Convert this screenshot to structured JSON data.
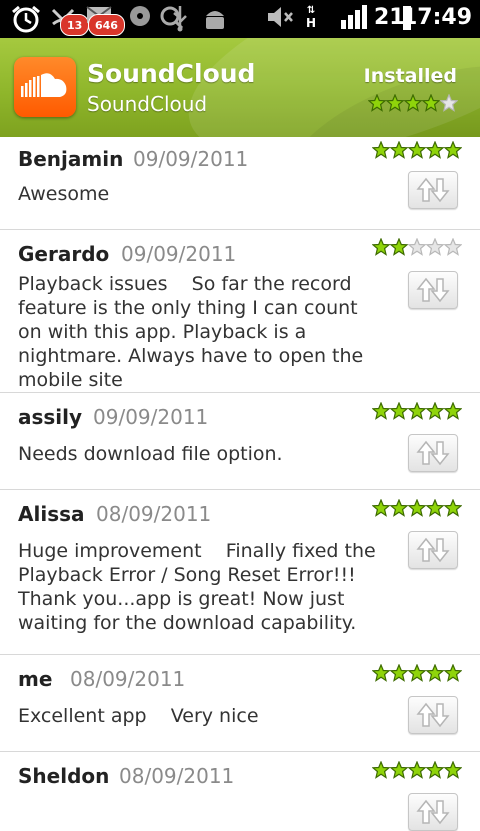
{
  "status_bar": {
    "badge_1": "13",
    "badge_2": "646",
    "network": "H",
    "signal_number": "21",
    "time": "17:49"
  },
  "app": {
    "title": "SoundCloud",
    "developer": "SoundCloud",
    "status": "Installed",
    "rating": 4,
    "max_rating": 5
  },
  "colors": {
    "header_green": "#8fb62b",
    "star_green": "#8fd40a",
    "brand_orange": "#ff6a00"
  },
  "reviews": [
    {
      "name": "Benjamin",
      "date": "09/09/2011",
      "text": "Awesome",
      "rating": 5
    },
    {
      "name": "Gerardo",
      "date": "09/09/2011",
      "text": "Playback issues    So far the record feature is the only thing I can count on with this app. Playback is a nightmare. Always have to open the mobile site",
      "rating": 2
    },
    {
      "name": "assily",
      "date": "09/09/2011",
      "text": "Needs download file option.",
      "rating": 5
    },
    {
      "name": "Alissa",
      "date": "08/09/2011",
      "text": "Huge improvement    Finally fixed the Playback Error / Song Reset Error!!! Thank you...app is great! Now just waiting for the download capability.",
      "rating": 5
    },
    {
      "name": "me",
      "date": "08/09/2011",
      "text": "Excellent app    Very nice",
      "rating": 5
    },
    {
      "name": "Sheldon",
      "date": "08/09/2011",
      "text": "",
      "rating": 5
    }
  ],
  "icons": {
    "vote": "vote-updown-icon"
  }
}
